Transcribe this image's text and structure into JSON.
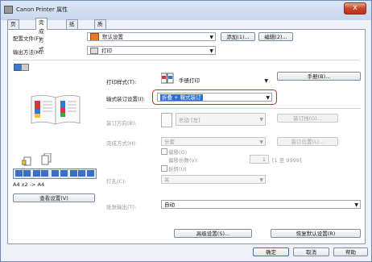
{
  "window": {
    "title": "Canon Printer 属性",
    "close_symbol": "x"
  },
  "tabs": [
    "页面设置",
    "完成方式",
    "纸张来源",
    "质量"
  ],
  "profile": {
    "label": "配置文件(F):",
    "value": "默认设置",
    "add_button": "添加(1)...",
    "edit_button": "编辑(2)..."
  },
  "output": {
    "label": "输出方法(M):",
    "value": "打印"
  },
  "print_style": {
    "label": "打印样式(T):",
    "value": "手册打印",
    "button": "手册(B)..."
  },
  "binding": {
    "label": "输式装订设置(I):",
    "value": "折叠 + 鞍式装订"
  },
  "binding_direction": {
    "label": "装订方向(B):",
    "value": "长边 [左]",
    "button": "装订线(G)..."
  },
  "finishing": {
    "label": "完成方式(H):",
    "value": "分套",
    "button": "装订位置(L)...",
    "offset_label": "偏移(O)",
    "offset_count_label": "偏移份数(V):",
    "offset_count_value": "1",
    "offset_range": "[1 至 9999]",
    "fold_label": "折转(U)"
  },
  "punch": {
    "label": "打孔(C):",
    "value": "关"
  },
  "paper_output": {
    "label": "纸张输出(T):",
    "value": "自动"
  },
  "preview": {
    "caption": "A4 x2 -> A4",
    "view_settings_button": "查看设置(V)"
  },
  "bottom": {
    "advanced_button": "高级设置(S)...",
    "restore_button": "恢复默认设置(R)",
    "ok_button": "确定",
    "cancel_button": "取消",
    "help_button": "帮助"
  },
  "colors": {
    "highlight_red": "#d8202a",
    "selection_blue": "#2b6fd6"
  }
}
